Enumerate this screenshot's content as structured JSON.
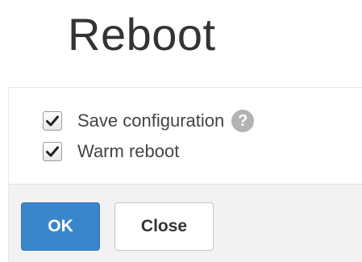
{
  "dialog": {
    "title": "Reboot"
  },
  "options": [
    {
      "label": "Save configuration",
      "checked": true,
      "help_icon": "question-circle-icon"
    },
    {
      "label": "Warm reboot",
      "checked": true
    }
  ],
  "buttons": {
    "ok_label": "OK",
    "close_label": "Close"
  },
  "colors": {
    "primary_button": "#3a86cc",
    "footer_background": "#f2f2f2",
    "help_icon": "#b3b3b3",
    "title_text": "#333333"
  }
}
